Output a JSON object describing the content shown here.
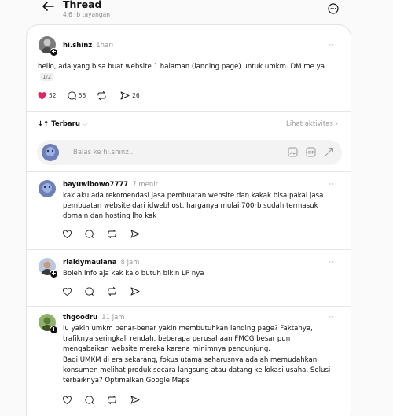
{
  "header": {
    "title": "Thread",
    "subtitle": "4,6 rb tayangan"
  },
  "main_post": {
    "username": "hi.shinz",
    "time": "1hari",
    "text": "hello, ada yang bisa buat website 1 halaman (landing page) untuk umkm. DM me ya",
    "pager": "1/2",
    "likes": "52",
    "comments": "66",
    "shares": "26",
    "like_color": "#e0245e"
  },
  "sort": {
    "label": "Terbaru",
    "activity_link": "Lihat aktivitas"
  },
  "reply": {
    "placeholder": "Balas ke hi.shinz..."
  },
  "replies": [
    {
      "username": "bayuwibowo7777",
      "time": "7 menit",
      "text": "kak aku ada rekomendasi jasa pembuatan website dan kakak bisa pakai jasa pembuatan website dari idwebhost, harganya mulai 700rb sudah termasuk domain dan hosting lho kak"
    },
    {
      "username": "rialdymaulana",
      "time": "8 jam",
      "text": "Boleh info aja kak kalo butuh bikin LP nya"
    },
    {
      "username": "thgoodru",
      "time": "11 jam",
      "text": "lu yakin umkm benar-benar yakin membutuhkan landing page? Faktanya, trafiknya seringkali rendah. beberapa perusahaan FMCG besar pun mengabaikan website mereka karena minimnya pengunjung.",
      "text2": "Bagi UMKM di era sekarang, fokus utama seharusnya adalah memudahkan konsumen melihat produk secara langsung atau datang ke lokasi usaha. Solusi terbaiknya? Optimalkan Google Maps"
    }
  ],
  "more_label": "···"
}
